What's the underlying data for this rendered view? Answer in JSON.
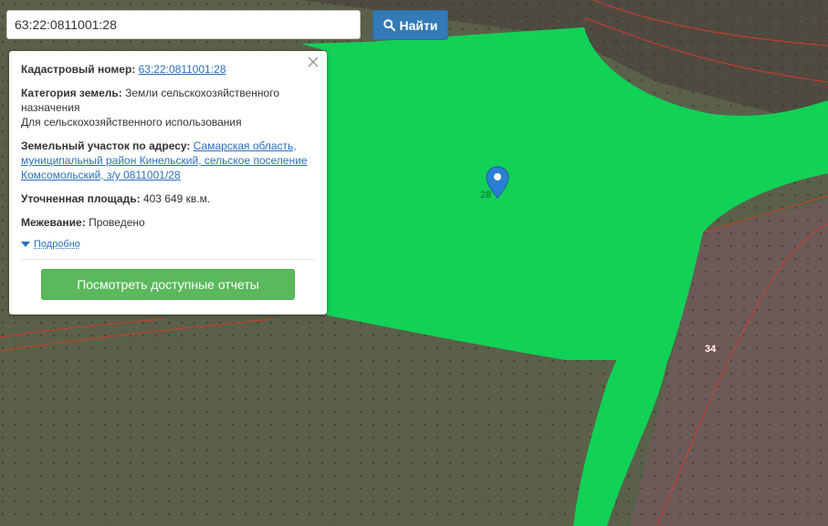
{
  "search": {
    "value": "63:22:0811001:28",
    "button_label": "Найти"
  },
  "popup": {
    "cadastral_label": "Кадастровый номер:",
    "cadastral_value": "63:22:0811001:28",
    "category_label": "Категория земель:",
    "category_value": "Земли сельскохозяйственного назначения",
    "usage_value": "Для сельскохозяйственного использования",
    "address_label": "Земельный участок по адресу:",
    "address_value": "Самарская область, муниципальный район Кинельский, сельское поселение Комсомольский, з/у 0811001/28",
    "area_label": "Уточненная площадь:",
    "area_value": "403 649 кв.м.",
    "survey_label": "Межевание:",
    "survey_value": "Проведено",
    "details_link": "Подробно",
    "reports_button": "Посмотреть доступные отчеты"
  },
  "map": {
    "parcel_labels": [
      "28",
      "34"
    ],
    "highlight_color": "#12d157",
    "boundary_color": "#d33b2f",
    "marker_color": "#2a7fd4"
  }
}
